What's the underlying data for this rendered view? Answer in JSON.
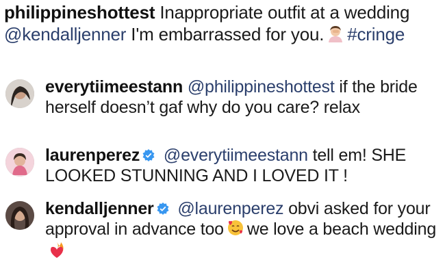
{
  "caption": {
    "username": "philippineshottest",
    "text1": "Inappropriate outfit at a wedding",
    "mention": "@kendalljenner",
    "text2": "I'm embarrassed for you.",
    "emoji": "person-facepalming-icon",
    "hashtag": "#cringe"
  },
  "comments": [
    {
      "username": "everytiimeestann",
      "verified": false,
      "mention": "@philippineshottest",
      "text": "if the bride herself doesn’t gaf why do you care? relax",
      "avatar": "avatar-dark-hair"
    },
    {
      "username": "laurenperez",
      "verified": true,
      "mention": "@everytiimeestann",
      "text": "tell em! SHE LOOKED STUNNING AND I LOVED IT !",
      "avatar": "avatar-pink"
    },
    {
      "username": "kendalljenner",
      "verified": true,
      "mention": "@laurenperez",
      "text_before_emoji": "obvi asked for your approval in advance too",
      "text_after_emoji": "we love a beach wedding",
      "emoji1": "smiling-face-with-hearts-icon",
      "emoji2": "heart-on-fire-icon",
      "avatar": "avatar-portrait"
    }
  ],
  "colors": {
    "mention": "#2b3f6c",
    "verified": "#3897f0",
    "text": "#1a1a1a"
  }
}
